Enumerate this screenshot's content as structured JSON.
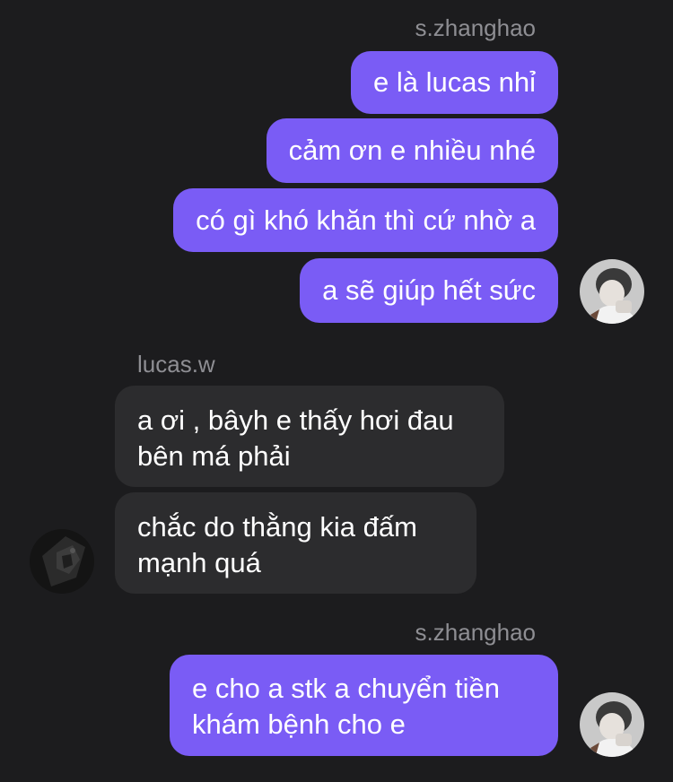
{
  "thread": {
    "groups": [
      {
        "sender": "s.zhanghao",
        "messages": [
          "e là lucas nhỉ",
          "cảm ơn e nhiều nhé",
          "có gì khó khăn thì cứ nhờ a",
          "a sẽ giúp hết sức"
        ]
      },
      {
        "sender": "lucas.w",
        "messages": [
          [
            "a ơi , bâyh e thấy hơi đau",
            "bên má phải"
          ],
          [
            "chắc do thằng kia đấm",
            "mạnh quá"
          ]
        ]
      },
      {
        "sender": "s.zhanghao",
        "messages": [
          [
            "e cho a stk a chuyển tiền",
            "khám bệnh cho e"
          ]
        ]
      }
    ]
  },
  "colors": {
    "background": "#1c1c1e",
    "outgoing_bubble": "#7a5cf5",
    "incoming_bubble": "#2c2c2e",
    "sender_label": "#8e8e93"
  }
}
